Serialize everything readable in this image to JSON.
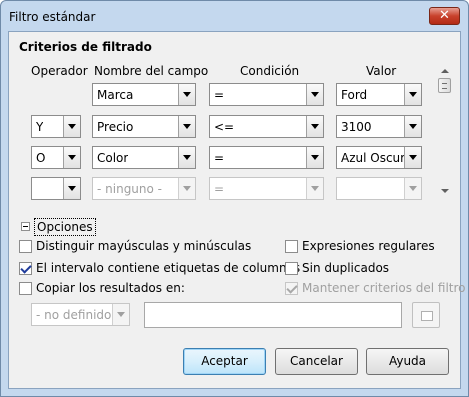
{
  "window": {
    "title": "Filtro estándar",
    "close_glyph": "✕"
  },
  "section_title": "Criterios de filtrado",
  "headers": {
    "operator": "Operador",
    "field": "Nombre del campo",
    "condition": "Condición",
    "value": "Valor"
  },
  "rows": [
    {
      "operator": "",
      "field": "Marca",
      "condition": "=",
      "value": "Ford",
      "enabled": true,
      "has_operator": false
    },
    {
      "operator": "Y",
      "field": "Precio",
      "condition": "<=",
      "value": "3100",
      "enabled": true,
      "has_operator": true
    },
    {
      "operator": "O",
      "field": "Color",
      "condition": "=",
      "value": "Azul Oscuro",
      "enabled": true,
      "has_operator": true
    },
    {
      "operator": "",
      "field": "- ninguno -",
      "condition": "=",
      "value": "",
      "enabled": false,
      "has_operator": true
    }
  ],
  "options": {
    "toggle_label": "Opciones",
    "case_sensitive": {
      "label": "Distinguir mayúsculas y minúsculas",
      "checked": false
    },
    "header_range": {
      "label": "El intervalo contiene etiquetas de columnas",
      "checked": true
    },
    "copy_results": {
      "label": "Copiar los resultados en:",
      "checked": false
    },
    "regex": {
      "label": "Expresiones regulares",
      "checked": false
    },
    "no_duplicates": {
      "label": "Sin duplicados",
      "checked": false
    },
    "keep_criteria": {
      "label": "Mantener criterios del filtro",
      "checked": true,
      "disabled": true
    },
    "copy_target_select": "- no definido -",
    "copy_target_value": ""
  },
  "buttons": {
    "accept": "Aceptar",
    "cancel": "Cancelar",
    "help": "Ayuda"
  },
  "icons": {
    "close": "close-icon",
    "expander": "collapse-minus-icon",
    "shrink": "shrink-dialog-icon"
  }
}
